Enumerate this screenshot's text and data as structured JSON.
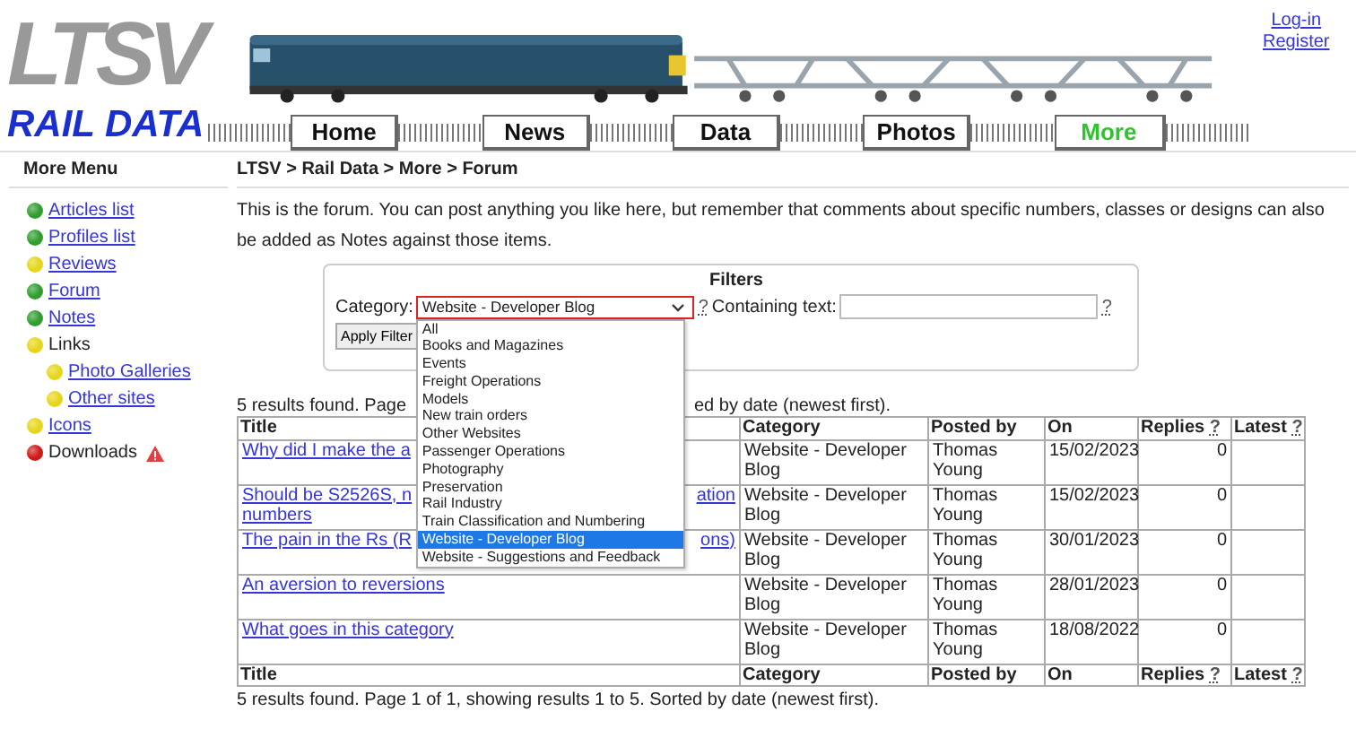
{
  "header": {
    "logo_top": "LTSV",
    "logo_bottom": "RAIL DATA",
    "nav": [
      {
        "label": "Home",
        "selected": false
      },
      {
        "label": "News",
        "selected": false
      },
      {
        "label": "Data",
        "selected": false
      },
      {
        "label": "Photos",
        "selected": false
      },
      {
        "label": "More",
        "selected": true
      }
    ],
    "account_links": [
      "Log-in",
      "Register"
    ]
  },
  "sidebar": {
    "title": "More Menu",
    "items": [
      {
        "label": "Articles list",
        "link": true,
        "color": "#2f9e2f"
      },
      {
        "label": "Profiles list",
        "link": true,
        "color": "#2f9e2f"
      },
      {
        "label": "Reviews",
        "link": true,
        "color": "#e6d619"
      },
      {
        "label": "Forum",
        "link": true,
        "color": "#2f9e2f"
      },
      {
        "label": "Notes",
        "link": true,
        "color": "#2f9e2f"
      },
      {
        "label": "Links",
        "link": false,
        "color": "#e6d619",
        "children": [
          {
            "label": "Photo Galleries",
            "link": true,
            "color": "#e6d619"
          },
          {
            "label": "Other sites",
            "link": true,
            "color": "#e6d619"
          }
        ]
      },
      {
        "label": "Icons",
        "link": true,
        "color": "#e6d619"
      },
      {
        "label": "Downloads",
        "link": false,
        "color": "#d11a1a",
        "warning": true
      }
    ]
  },
  "breadcrumb": "LTSV > Rail Data > More > Forum",
  "intro": "This is the forum. You can post anything you like here, but remember that comments about specific numbers, classes or designs can also be added as Notes against those items.",
  "filters": {
    "title": "Filters",
    "category_label": "Category:",
    "category_value": "Website - Developer Blog",
    "category_help": "?",
    "text_label": "Containing text:",
    "text_help": "?",
    "apply_button": "Apply Filter",
    "options": [
      {
        "label": "All",
        "selected": false
      },
      {
        "label": "Books and Magazines",
        "selected": false
      },
      {
        "label": "Events",
        "selected": false
      },
      {
        "label": "Freight Operations",
        "selected": false
      },
      {
        "label": "Models",
        "selected": false
      },
      {
        "label": "New train orders",
        "selected": false
      },
      {
        "label": "Other Websites",
        "selected": false
      },
      {
        "label": "Passenger Operations",
        "selected": false
      },
      {
        "label": "Photography",
        "selected": false
      },
      {
        "label": "Preservation",
        "selected": false
      },
      {
        "label": "Rail Industry",
        "selected": false
      },
      {
        "label": "Train Classification and Numbering",
        "selected": false
      },
      {
        "label": "Website - Developer Blog",
        "selected": true
      },
      {
        "label": "Website - Suggestions and Feedback",
        "selected": false
      }
    ]
  },
  "results_top": [
    "5 results found. Page",
    "ed by date (newest first)."
  ],
  "table": {
    "columns": [
      {
        "label": "Title"
      },
      {
        "label": "Category"
      },
      {
        "label": "Posted by"
      },
      {
        "label": "On"
      },
      {
        "label": "Replies",
        "help": "?"
      },
      {
        "label": "Latest",
        "help": "?"
      }
    ],
    "rows": [
      {
        "title_lines": [
          [
            "Why did I make the a"
          ]
        ],
        "category": "Website - Developer Blog",
        "posted_by": "Thomas Young",
        "on": "15/02/2023",
        "replies": "0"
      },
      {
        "title_lines": [
          [
            "Should be S2526S, n",
            "ation"
          ],
          [
            "numbers"
          ]
        ],
        "category": "Website - Developer Blog",
        "posted_by": "Thomas Young",
        "on": "15/02/2023",
        "replies": "0"
      },
      {
        "title_lines": [
          [
            "The pain in the Rs (R",
            "ons)"
          ]
        ],
        "category": "Website - Developer Blog",
        "posted_by": "Thomas Young",
        "on": "30/01/2023",
        "replies": "0"
      },
      {
        "title_lines": [
          [
            "An aversion to reversions"
          ]
        ],
        "category": "Website - Developer Blog",
        "posted_by": "Thomas Young",
        "on": "28/01/2023",
        "replies": "0"
      },
      {
        "title_lines": [
          [
            "What goes in this category"
          ]
        ],
        "category": "Website - Developer Blog",
        "posted_by": "Thomas Young",
        "on": "18/08/2022",
        "replies": "0"
      }
    ],
    "footer_columns": [
      {
        "label": "Title"
      },
      {
        "label": "Category"
      },
      {
        "label": "Posted by"
      },
      {
        "label": "On"
      },
      {
        "label": "Replies",
        "help": "?"
      },
      {
        "label": "Latest",
        "help": "?"
      }
    ]
  },
  "results_bottom": "5 results found. Page 1 of 1, showing results 1 to 5. Sorted by date (newest first)."
}
